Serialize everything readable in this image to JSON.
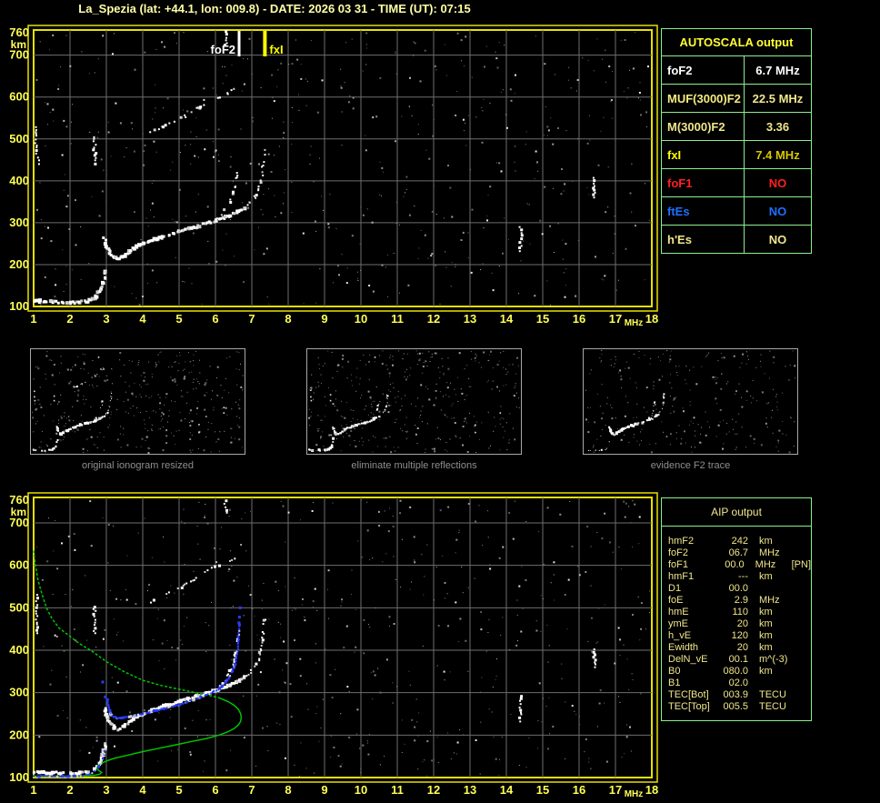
{
  "title": "La_Spezia (lat: +44.1, lon: 009.8) - DATE: 2026 03 31 - TIME (UT): 07:15",
  "colors": {
    "background": "#000000",
    "title_text": "#ffffa6",
    "axis_text": "#ffff55",
    "plot_border": "#e8e000",
    "grid_line": "#6e6e6e",
    "table_border": "#8cf08c",
    "trace_white": "#ffffff",
    "profile_green": "#00c400",
    "scaled_trace_blue": "#2a3cff",
    "caption_gray": "#8f8f8f"
  },
  "autoscala_table": {
    "title": "AUTOSCALA output",
    "rows": [
      {
        "label": "foF2",
        "value": "6.7 MHz",
        "label_color": "#ffffff",
        "value_color": "#ffffff"
      },
      {
        "label": "MUF(3000)F2",
        "value": "22.5 MHz",
        "label_color": "#f4ec7e",
        "value_color": "#f0e68c"
      },
      {
        "label": "M(3000)F2",
        "value": "3.36",
        "label_color": "#f0e68c",
        "value_color": "#f0e68c"
      },
      {
        "label": "fxI",
        "value": "7.4 MHz",
        "label_color": "#ffff00",
        "value_color": "#d8c800"
      },
      {
        "label": "foF1",
        "value": "NO",
        "label_color": "#ff2020",
        "value_color": "#ff2020"
      },
      {
        "label": "ftEs",
        "value": "NO",
        "label_color": "#1f6fff",
        "value_color": "#1f6fff"
      },
      {
        "label": "h'Es",
        "value": "NO",
        "label_color": "#f0e68c",
        "value_color": "#f0e68c"
      }
    ]
  },
  "aip_table": {
    "title": "AIP output",
    "rows": [
      {
        "label": "hmF2",
        "value": "242",
        "unit": "km",
        "extra": ""
      },
      {
        "label": "foF2",
        "value": "06.7",
        "unit": "MHz",
        "extra": ""
      },
      {
        "label": "foF1",
        "value": "00.0",
        "unit": "MHz",
        "extra": "[PN]"
      },
      {
        "label": "hmF1",
        "value": "---",
        "unit": "km",
        "extra": ""
      },
      {
        "label": "D1",
        "value": "00.0",
        "unit": "",
        "extra": ""
      },
      {
        "label": "foE",
        "value": "2.9",
        "unit": "MHz",
        "extra": ""
      },
      {
        "label": "hmE",
        "value": "110",
        "unit": "km",
        "extra": ""
      },
      {
        "label": "ymE",
        "value": "20",
        "unit": "km",
        "extra": ""
      },
      {
        "label": "h_vE",
        "value": "120",
        "unit": "km",
        "extra": ""
      },
      {
        "label": "Ewidth",
        "value": "20",
        "unit": "km",
        "extra": ""
      },
      {
        "label": "DelN_vE",
        "value": "00.1",
        "unit": "m^(-3)",
        "extra": ""
      },
      {
        "label": "B0",
        "value": "080.0",
        "unit": "km",
        "extra": ""
      },
      {
        "label": "B1",
        "value": "02.0",
        "unit": "",
        "extra": ""
      },
      {
        "label": "TEC[Bot]",
        "value": "003.9",
        "unit": "TECU",
        "extra": ""
      },
      {
        "label": "TEC[Top]",
        "value": "005.5",
        "unit": "TECU",
        "extra": ""
      }
    ]
  },
  "chart_data": {
    "type": "scatter",
    "xlabel": "MHz",
    "ylabel": "km",
    "xlim": [
      1,
      18
    ],
    "ylim": [
      100,
      760
    ],
    "x_ticks": [
      1,
      2,
      3,
      4,
      5,
      6,
      7,
      8,
      9,
      10,
      11,
      12,
      13,
      14,
      15,
      16,
      17,
      18
    ],
    "y_ticks": [
      760,
      700,
      600,
      500,
      400,
      300,
      200,
      100
    ],
    "grid": true,
    "shared_ionogram": {
      "e_trace": [
        [
          1.0,
          113
        ],
        [
          1.25,
          112
        ],
        [
          1.5,
          111
        ],
        [
          1.75,
          110
        ],
        [
          2.0,
          110
        ],
        [
          2.25,
          110
        ],
        [
          2.45,
          112
        ],
        [
          2.6,
          117
        ],
        [
          2.72,
          124
        ],
        [
          2.82,
          134
        ],
        [
          2.9,
          148
        ],
        [
          2.95,
          166
        ],
        [
          2.98,
          184
        ]
      ],
      "f_trace": [
        [
          2.95,
          262
        ],
        [
          3.0,
          248
        ],
        [
          3.05,
          236
        ],
        [
          3.12,
          226
        ],
        [
          3.22,
          218
        ],
        [
          3.35,
          214
        ],
        [
          3.5,
          222
        ],
        [
          3.65,
          233
        ],
        [
          3.82,
          242
        ],
        [
          4.0,
          250
        ],
        [
          4.25,
          258
        ],
        [
          4.5,
          265
        ],
        [
          4.75,
          272
        ],
        [
          5.0,
          279
        ],
        [
          5.25,
          285
        ],
        [
          5.5,
          291
        ],
        [
          5.75,
          298
        ],
        [
          6.0,
          305
        ],
        [
          6.2,
          311
        ],
        [
          6.4,
          318
        ],
        [
          6.6,
          326
        ],
        [
          6.8,
          336
        ]
      ],
      "fx_branch": [
        [
          6.8,
          336
        ],
        [
          6.95,
          347
        ],
        [
          7.08,
          361
        ],
        [
          7.18,
          378
        ],
        [
          7.25,
          398
        ],
        [
          7.29,
          420
        ],
        [
          7.32,
          443
        ],
        [
          7.34,
          462
        ],
        [
          7.35,
          480
        ]
      ],
      "f_o_branch": [
        [
          6.05,
          308
        ],
        [
          6.18,
          320
        ],
        [
          6.3,
          334
        ],
        [
          6.4,
          350
        ],
        [
          6.48,
          368
        ],
        [
          6.54,
          388
        ],
        [
          6.58,
          408
        ],
        [
          6.6,
          426
        ]
      ],
      "multi_hop_trace": [
        [
          4.15,
          512
        ],
        [
          4.35,
          521
        ],
        [
          4.55,
          529
        ],
        [
          4.75,
          537
        ],
        [
          4.95,
          545
        ],
        [
          5.15,
          554
        ],
        [
          5.35,
          564
        ],
        [
          5.55,
          575
        ],
        [
          5.72,
          585
        ],
        [
          5.9,
          592
        ],
        [
          6.1,
          599
        ],
        [
          6.3,
          607
        ],
        [
          6.5,
          618
        ]
      ],
      "spread_columns": [
        [
          1.08,
          465,
          532
        ],
        [
          1.12,
          440,
          462
        ],
        [
          2.68,
          440,
          506
        ],
        [
          6.28,
          724,
          757
        ],
        [
          14.4,
          232,
          292
        ],
        [
          16.42,
          360,
          408
        ]
      ]
    },
    "top_plot": {
      "markers": [
        {
          "label": "foF2",
          "mhz": 6.65,
          "color": "#ffffff",
          "side": "left"
        },
        {
          "label": "fxI",
          "mhz": 7.36,
          "color": "#ffff00",
          "side": "right"
        }
      ]
    },
    "bottom_plot": {
      "profile_topside": [
        [
          1.0,
          635
        ],
        [
          1.05,
          600
        ],
        [
          1.12,
          565
        ],
        [
          1.22,
          535
        ],
        [
          1.35,
          500
        ],
        [
          1.5,
          475
        ],
        [
          1.7,
          452
        ],
        [
          1.95,
          436
        ],
        [
          2.25,
          416
        ],
        [
          2.6,
          398
        ],
        [
          3.0,
          373
        ],
        [
          3.5,
          349
        ],
        [
          4.0,
          329
        ],
        [
          4.5,
          317
        ],
        [
          5.0,
          308
        ],
        [
          5.5,
          299
        ],
        [
          5.85,
          293
        ],
        [
          6.1,
          288
        ]
      ],
      "profile_bottomside": [
        [
          6.1,
          288
        ],
        [
          6.35,
          279
        ],
        [
          6.52,
          270
        ],
        [
          6.63,
          261
        ],
        [
          6.69,
          251
        ],
        [
          6.71,
          242
        ],
        [
          6.69,
          232
        ],
        [
          6.63,
          224
        ],
        [
          6.52,
          216
        ],
        [
          6.35,
          208
        ],
        [
          6.1,
          200
        ],
        [
          5.75,
          192
        ],
        [
          5.35,
          185
        ],
        [
          4.9,
          177
        ],
        [
          4.45,
          169
        ],
        [
          4.0,
          161
        ],
        [
          3.6,
          153
        ],
        [
          3.25,
          146
        ],
        [
          3.0,
          139
        ],
        [
          2.85,
          133
        ],
        [
          2.76,
          127
        ],
        [
          2.74,
          121
        ],
        [
          2.8,
          116
        ],
        [
          2.87,
          112
        ],
        [
          2.82,
          108
        ],
        [
          2.65,
          105
        ],
        [
          2.4,
          104
        ],
        [
          2.0,
          103
        ],
        [
          1.5,
          103
        ],
        [
          1.0,
          103
        ]
      ],
      "blue_e_trace": [
        [
          1.0,
          103
        ],
        [
          2.35,
          103
        ]
      ],
      "blue_e_rise": [
        [
          2.45,
          106
        ],
        [
          2.6,
          111
        ],
        [
          2.72,
          118
        ],
        [
          2.82,
          128
        ],
        [
          2.9,
          143
        ],
        [
          2.96,
          162
        ]
      ],
      "blue_f_trace": [
        [
          3.02,
          284
        ],
        [
          3.05,
          270
        ],
        [
          3.08,
          258
        ],
        [
          3.12,
          249
        ],
        [
          3.2,
          243
        ],
        [
          3.3,
          240
        ],
        [
          3.45,
          241
        ],
        [
          3.6,
          243
        ],
        [
          3.8,
          246
        ],
        [
          4.0,
          250
        ],
        [
          4.2,
          254
        ],
        [
          4.4,
          258
        ],
        [
          4.6,
          263
        ],
        [
          4.8,
          267
        ],
        [
          5.0,
          272
        ],
        [
          5.2,
          277
        ],
        [
          5.4,
          283
        ],
        [
          5.6,
          289
        ],
        [
          5.8,
          296
        ],
        [
          6.0,
          304
        ],
        [
          6.15,
          313
        ],
        [
          6.28,
          324
        ],
        [
          6.38,
          336
        ],
        [
          6.47,
          351
        ],
        [
          6.53,
          367
        ],
        [
          6.58,
          385
        ],
        [
          6.61,
          403
        ],
        [
          6.63,
          422
        ],
        [
          6.65,
          445
        ],
        [
          6.66,
          465
        ]
      ],
      "blue_isolated_points": [
        [
          2.9,
          325
        ],
        [
          2.97,
          290
        ],
        [
          6.66,
          478
        ],
        [
          6.68,
          500
        ]
      ]
    },
    "mini_panels": [
      {
        "caption": "original ionogram resized"
      },
      {
        "caption": "eliminate multiple reflections"
      },
      {
        "caption": "evidence F2 trace"
      }
    ]
  }
}
